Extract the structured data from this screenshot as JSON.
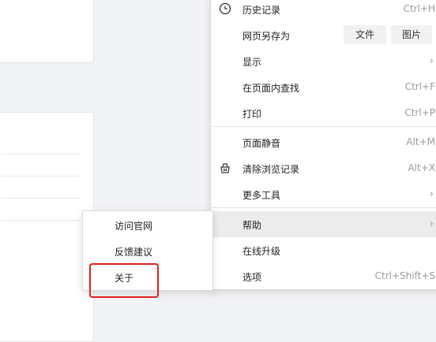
{
  "menu": {
    "history": {
      "label": "历史记录",
      "shortcut": "Ctrl+H"
    },
    "save_as": {
      "label": "网页另存为",
      "file_button": "文件",
      "image_button": "图片"
    },
    "display": {
      "label": "显示"
    },
    "find": {
      "label": "在页面内查找",
      "shortcut": "Ctrl+F"
    },
    "print": {
      "label": "打印",
      "shortcut": "Ctrl+P"
    },
    "mute": {
      "label": "页面静音",
      "shortcut": "Alt+M"
    },
    "clear": {
      "label": "清除浏览记录",
      "shortcut": "Alt+X"
    },
    "more_tools": {
      "label": "更多工具"
    },
    "help": {
      "label": "帮助"
    },
    "upgrade": {
      "label": "在线升级"
    },
    "options": {
      "label": "选项",
      "shortcut": "Ctrl+Shift+S"
    }
  },
  "submenu": {
    "visit": "访问官网",
    "feedback": "反馈建议",
    "about": "关于"
  },
  "colors": {
    "hover_bg": "#ececec",
    "highlight": "#e02020"
  }
}
